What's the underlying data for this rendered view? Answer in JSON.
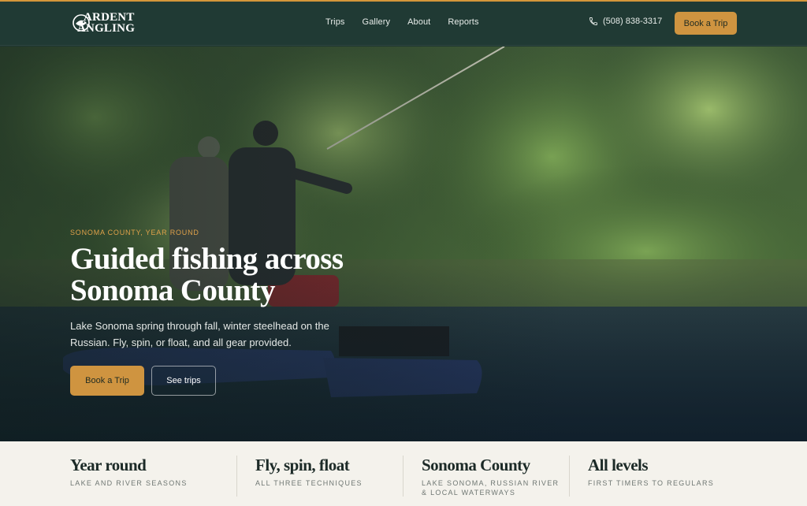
{
  "brand": {
    "logo_line1": "ARDENT",
    "logo_line2": "ANGLING",
    "accent": "#cf9440",
    "header_bg": "#203a34"
  },
  "nav": {
    "items": [
      {
        "label": "Trips"
      },
      {
        "label": "Gallery"
      },
      {
        "label": "About"
      },
      {
        "label": "Reports"
      }
    ]
  },
  "header": {
    "phone": "(508) 838-3317",
    "book_label": "Book a Trip",
    "phone_icon": "phone-icon"
  },
  "hero": {
    "eyebrow": "SONOMA COUNTY, YEAR ROUND",
    "title": "Guided fishing across Sonoma County",
    "subtitle": "Lake Sonoma spring through fall, winter steelhead on the Russian. Fly, spin, or float, and all gear provided.",
    "primary_button": "Book a Trip",
    "secondary_button": "See trips"
  },
  "features": [
    {
      "title": "Year round",
      "subtitle": "LAKE AND RIVER SEASONS"
    },
    {
      "title": "Fly, spin, float",
      "subtitle": "ALL THREE TECHNIQUES"
    },
    {
      "title": "Sonoma County",
      "subtitle": "LAKE SONOMA, RUSSIAN RIVER & LOCAL WATERWAYS"
    },
    {
      "title": "All levels",
      "subtitle": "FIRST TIMERS TO REGULARS"
    }
  ]
}
